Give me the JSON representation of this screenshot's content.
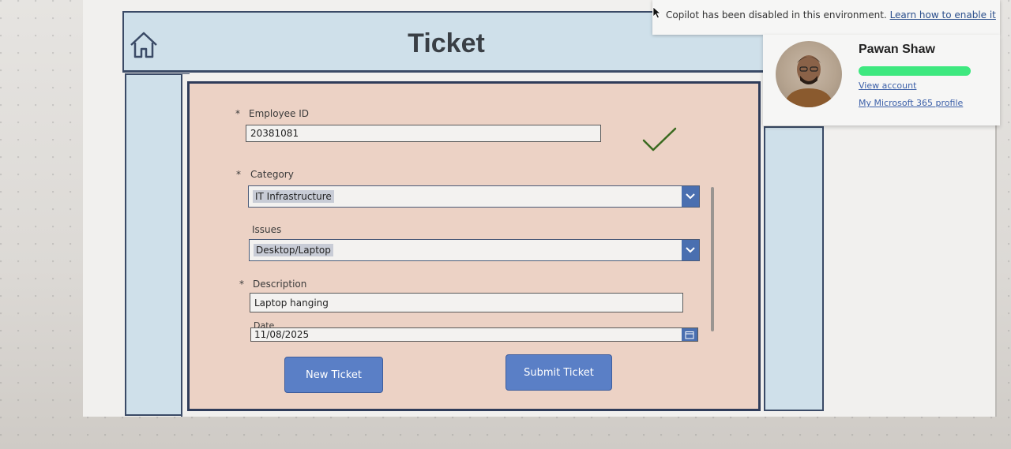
{
  "header": {
    "title": "Ticket"
  },
  "form": {
    "employee_id": {
      "label": "Employee ID",
      "required_marker": "*",
      "value": "20381081"
    },
    "category": {
      "label": "Category",
      "required_marker": "*",
      "value": "IT Infrastructure"
    },
    "issues": {
      "label": "Issues",
      "value": "Desktop/Laptop"
    },
    "description": {
      "label": "Description",
      "required_marker": "*",
      "value": "Laptop hanging"
    },
    "date": {
      "label": "Date",
      "value": "11/08/2025"
    },
    "buttons": {
      "new_ticket": "New Ticket",
      "submit_ticket": "Submit Ticket"
    }
  },
  "copilot_banner": {
    "message": "Copilot has been disabled in this environment.",
    "link": "Learn how to enable it"
  },
  "profile": {
    "name": "Pawan Shaw",
    "view_account": "View account",
    "m365_profile": "My Microsoft 365 profile"
  },
  "colors": {
    "header_bg": "#cfe0ea",
    "form_bg": "#ecd2c5",
    "button_bg": "#5a7fc6",
    "border": "#2f3c5a",
    "check": "#3a6a1f"
  }
}
